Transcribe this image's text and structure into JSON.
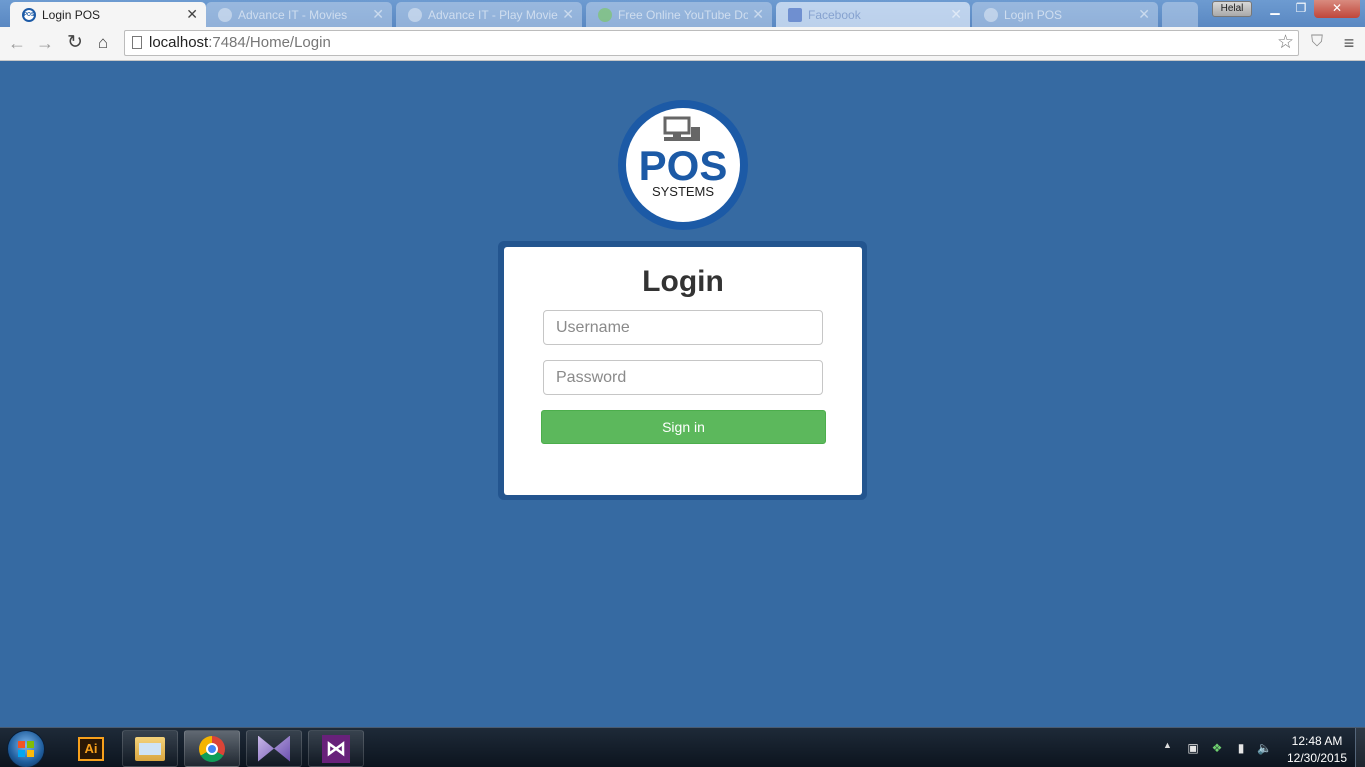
{
  "browser": {
    "tabs": [
      {
        "title": "Login POS",
        "active": true
      },
      {
        "title": "Advance IT - Movies",
        "active": false
      },
      {
        "title": "Advance IT - Play Movie",
        "active": false
      },
      {
        "title": "Free Online YouTube Do",
        "active": false
      },
      {
        "title": "Facebook",
        "active": false
      },
      {
        "title": "Login POS",
        "active": false
      }
    ],
    "user_badge": "Helal",
    "url_host": "localhost",
    "url_rest": ":7484/Home/Login"
  },
  "page": {
    "logo_text": "POS",
    "logo_subtext": "SYSTEMS",
    "login_title": "Login",
    "username_placeholder": "Username",
    "password_placeholder": "Password",
    "signin_label": "Sign in",
    "colors": {
      "background": "#366aa2",
      "button": "#5cb85c",
      "logo_blue": "#1c5aa6"
    }
  },
  "taskbar": {
    "apps": [
      "illustrator-icon",
      "file-explorer-icon",
      "chrome-icon",
      "visual-studio-blend-icon",
      "visual-studio-icon"
    ],
    "clock_time": "12:48 AM",
    "clock_date": "12/30/2015"
  }
}
